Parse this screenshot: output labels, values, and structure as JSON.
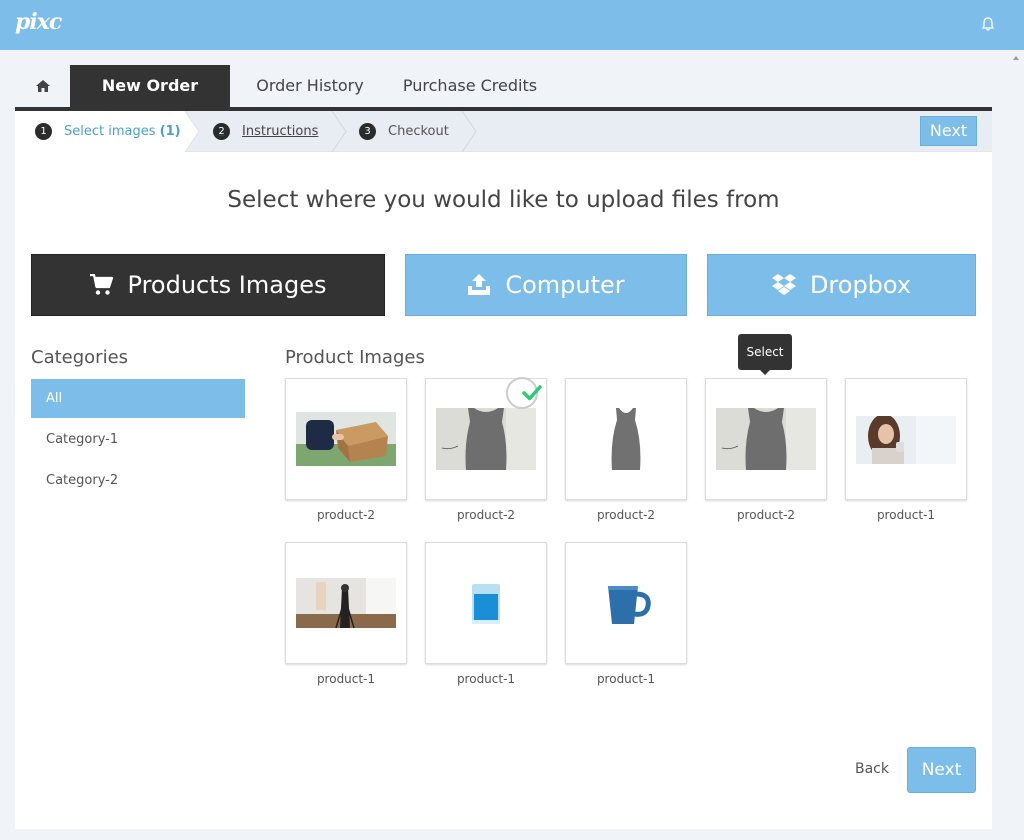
{
  "app": {
    "logo": "pixc"
  },
  "tabs": [
    {
      "label": "New Order"
    },
    {
      "label": "Order History"
    },
    {
      "label": "Purchase Credits"
    }
  ],
  "steps": [
    {
      "num": "1",
      "label": "Select images",
      "count": "(1)"
    },
    {
      "num": "2",
      "label": "Instructions"
    },
    {
      "num": "3",
      "label": "Checkout"
    }
  ],
  "stepbar": {
    "next_label": "Next"
  },
  "headline": "Select where you would like to upload files from",
  "sources": [
    {
      "label": "Products Images",
      "icon": "cart-icon"
    },
    {
      "label": "Computer",
      "icon": "upload-icon"
    },
    {
      "label": "Dropbox",
      "icon": "dropbox-icon"
    }
  ],
  "categories": {
    "title": "Categories",
    "items": [
      "All",
      "Category-1",
      "Category-2"
    ]
  },
  "products": {
    "title": "Product Images",
    "tooltip": "Select",
    "items": [
      {
        "label": "product-2",
        "selected": false
      },
      {
        "label": "product-2",
        "selected": true
      },
      {
        "label": "product-2",
        "selected": false
      },
      {
        "label": "product-2",
        "selected": false
      },
      {
        "label": "product-1",
        "selected": false
      },
      {
        "label": "product-1",
        "selected": false
      },
      {
        "label": "product-1",
        "selected": false
      },
      {
        "label": "product-1",
        "selected": false
      }
    ]
  },
  "footer": {
    "back_label": "Back",
    "next_label": "Next"
  },
  "colors": {
    "accent": "#7dbde9",
    "dark": "#333333",
    "check": "#2ecc71"
  }
}
